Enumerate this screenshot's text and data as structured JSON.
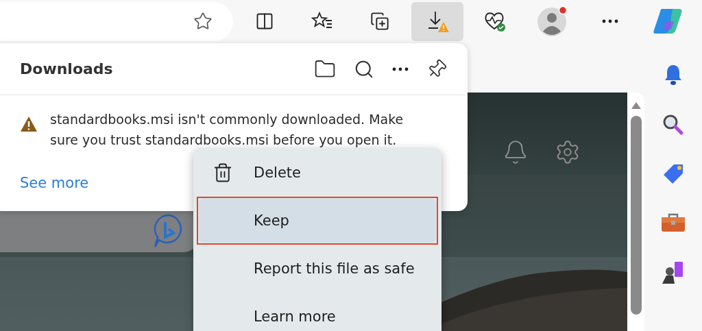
{
  "toolbar": {
    "items": [
      {
        "kind": "split",
        "selected": false
      },
      {
        "kind": "favorites",
        "selected": false
      },
      {
        "kind": "collections",
        "selected": false
      },
      {
        "kind": "downloads",
        "selected": true
      },
      {
        "kind": "health",
        "selected": false
      },
      {
        "kind": "profile",
        "selected": false
      },
      {
        "kind": "more",
        "selected": false
      },
      {
        "kind": "copilot",
        "selected": false
      }
    ]
  },
  "downloads_panel": {
    "title": "Downloads",
    "warning": "standardbooks.msi isn't commonly downloaded. Make sure you trust standardbooks.msi before you open it.",
    "link": "See more"
  },
  "context_menu": {
    "items": [
      {
        "label": "Delete",
        "kind": "trash",
        "selected": false
      },
      {
        "label": "Keep",
        "kind": "plain",
        "selected": true
      },
      {
        "label": "Report this file as safe",
        "kind": "plain",
        "selected": false
      },
      {
        "label": "Learn more",
        "kind": "plain",
        "selected": false
      }
    ]
  }
}
